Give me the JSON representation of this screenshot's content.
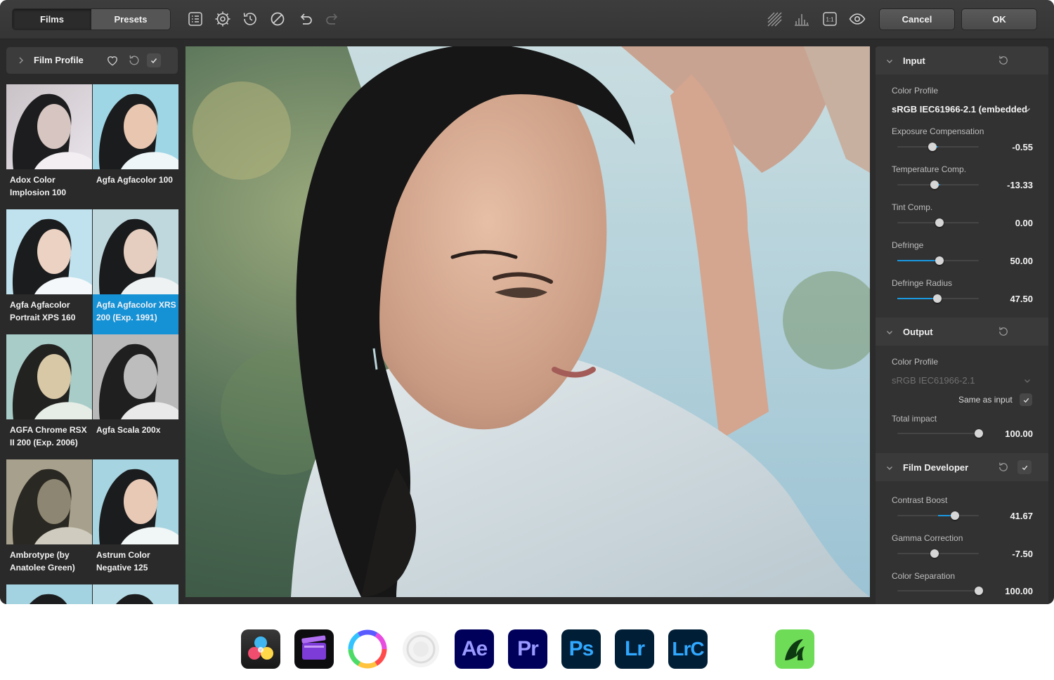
{
  "toolbar": {
    "tabs": [
      {
        "label": "Films",
        "active": true
      },
      {
        "label": "Presets",
        "active": false
      }
    ],
    "compare_badge": "1:1",
    "cancel_label": "Cancel",
    "ok_label": "OK"
  },
  "film_panel": {
    "title": "Film Profile",
    "items": [
      {
        "label": "Adox Color Implosion 100",
        "selected": false
      },
      {
        "label": "Agfa Agfacolor 100",
        "selected": false
      },
      {
        "label": "Agfa Agfacolor Portrait XPS 160",
        "selected": false
      },
      {
        "label": "Agfa Agfacolor XRS 200 (Exp. 1991)",
        "selected": true
      },
      {
        "label": "AGFA Chrome RSX II 200 (Exp. 2006)",
        "selected": false
      },
      {
        "label": "Agfa Scala 200x",
        "selected": false
      },
      {
        "label": "Ambrotype (by Anatolee Green)",
        "selected": false
      },
      {
        "label": "Astrum Color Negative 125",
        "selected": false
      }
    ]
  },
  "input": {
    "title": "Input",
    "color_profile_label": "Color Profile",
    "color_profile_value": "sRGB IEC61966-2.1 (embedded",
    "params": [
      {
        "label": "Exposure Compensation",
        "value": "-0.55",
        "level": 0.43
      },
      {
        "label": "Temperature Comp.",
        "value": "-13.33",
        "level": 0.46
      },
      {
        "label": "Tint Comp.",
        "value": "0.00",
        "level": 0.52
      },
      {
        "label": "Defringe",
        "value": "50.00",
        "level": 0.52
      },
      {
        "label": "Defringe Radius",
        "value": "47.50",
        "level": 0.49
      }
    ]
  },
  "output": {
    "title": "Output",
    "color_profile_label": "Color Profile",
    "color_profile_value": "sRGB IEC61966-2.1",
    "same_as_input_label": "Same as input",
    "total_impact_label": "Total impact",
    "total_impact_value": "100.00",
    "total_impact_level": 1.0
  },
  "film_developer": {
    "title": "Film Developer",
    "params": [
      {
        "label": "Contrast Boost",
        "value": "41.67",
        "level": 0.71
      },
      {
        "label": "Gamma Correction",
        "value": "-7.50",
        "level": 0.46
      },
      {
        "label": "Color Separation",
        "value": "100.00",
        "level": 1.0
      }
    ]
  },
  "apps": [
    {
      "name": "davinci-resolve-icon"
    },
    {
      "name": "final-cut-icon"
    },
    {
      "name": "color-wheel-icon"
    },
    {
      "name": "capture-one-icon"
    },
    {
      "name": "after-effects-icon",
      "text": "Ae"
    },
    {
      "name": "premiere-pro-icon",
      "text": "Pr"
    },
    {
      "name": "photoshop-icon",
      "text": "Ps"
    },
    {
      "name": "lightroom-icon",
      "text": "Lr"
    },
    {
      "name": "lightroom-classic-icon",
      "text": "LrC"
    },
    {
      "name": "affinity-icon"
    }
  ],
  "colors": {
    "accent": "#1591d6",
    "panel": "#323232",
    "background": "#2b2b2b"
  }
}
